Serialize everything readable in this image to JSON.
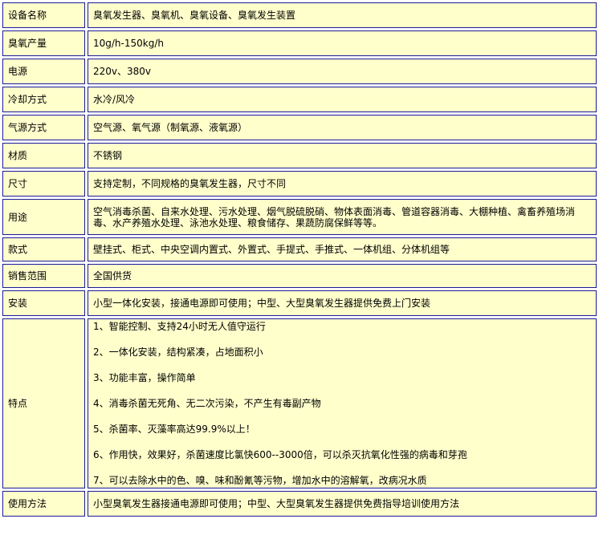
{
  "rows": [
    {
      "label": "设备名称",
      "value": "臭氧发生器、臭氧机、臭氧设备、臭氧发生装置"
    },
    {
      "label": "臭氧产量",
      "value": "10g/h-150kg/h"
    },
    {
      "label": "电源",
      "value": "220v、380v"
    },
    {
      "label": "冷却方式",
      "value": "水冷/风冷"
    },
    {
      "label": "气源方式",
      "value": "空气源、氧气源（制氧源、液氧源）"
    },
    {
      "label": "材质",
      "value": "不锈钢"
    },
    {
      "label": "尺寸",
      "value": "支持定制，不同规格的臭氧发生器，尺寸不同"
    },
    {
      "label": "用途",
      "value": "空气消毒杀菌、自来水处理、污水处理、烟气脱硫脱硝、物体表面消毒、管道容器消毒、大棚种植、禽畜养殖场消毒、水产养殖水处理、泳池水处理、粮食储存、果蔬防腐保鲜等等。"
    },
    {
      "label": "款式",
      "value": "壁挂式、柜式、中央空调内置式、外置式、手提式、手推式、一体机组、分体机组等"
    },
    {
      "label": "销售范围",
      "value": "全国供货"
    },
    {
      "label": "安装",
      "value": "小型一体化安装，接通电源即可使用；中型、大型臭氧发生器提供免费上门安装"
    }
  ],
  "features": {
    "label": "特点",
    "items": [
      "1、智能控制、支持24小时无人值守运行",
      "2、一体化安装，结构紧凑，占地面积小",
      "3、功能丰富，操作简单",
      "4、消毒杀菌无死角、无二次污染，不产生有毒副产物",
      "5、杀菌率、灭藻率高达99.9%以上！",
      "6、作用快，效果好，杀菌速度比氯快600--3000倍，可以杀灭抗氧化性强的病毒和芽孢",
      "7、可以去除水中的色、嗅、味和酚氰等污物，增加水中的溶解氧，改病况水质"
    ]
  },
  "usage": {
    "label": "使用方法",
    "value": "小型臭氧发生器接通电源即可使用；中型、大型臭氧发生器提供免费指导培训使用方法"
  }
}
